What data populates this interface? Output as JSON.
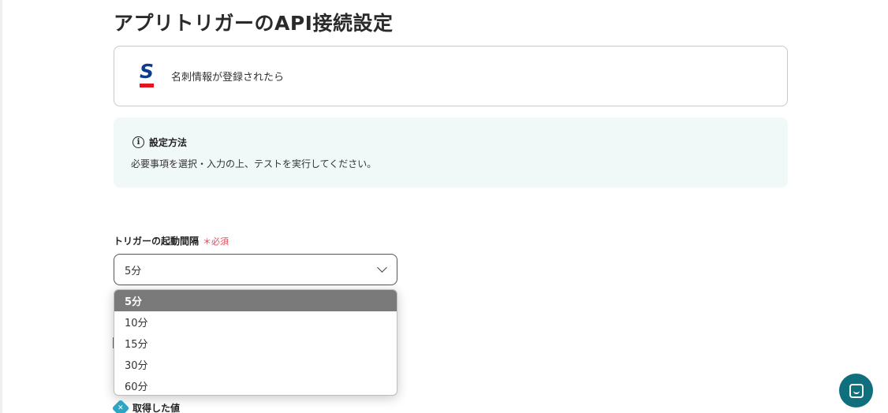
{
  "page": {
    "title": "アプリトリガーのAPI接続設定"
  },
  "app_card": {
    "logo_icon": "sansan-logo-icon",
    "trigger_text": "名刺情報が登録されたら"
  },
  "info_box": {
    "title": "設定方法",
    "text": "必要事項を選択・入力の上、テストを実行してください。"
  },
  "field": {
    "label": "トリガーの起動間隔",
    "required": "＊必須",
    "selected_value": "5分"
  },
  "dropdown": {
    "options": [
      {
        "label": "5分",
        "selected": true
      },
      {
        "label": "10分",
        "selected": false
      },
      {
        "label": "15分",
        "selected": false
      },
      {
        "label": "30分",
        "selected": false
      },
      {
        "label": "60分",
        "selected": false
      }
    ]
  },
  "acquired": {
    "label": "取得した値"
  },
  "colors": {
    "accent_teal": "#0f6f7c",
    "required_red": "#e04a5a",
    "info_bg": "#f1f9f8",
    "selected_option_bg": "#7a7a7a"
  }
}
